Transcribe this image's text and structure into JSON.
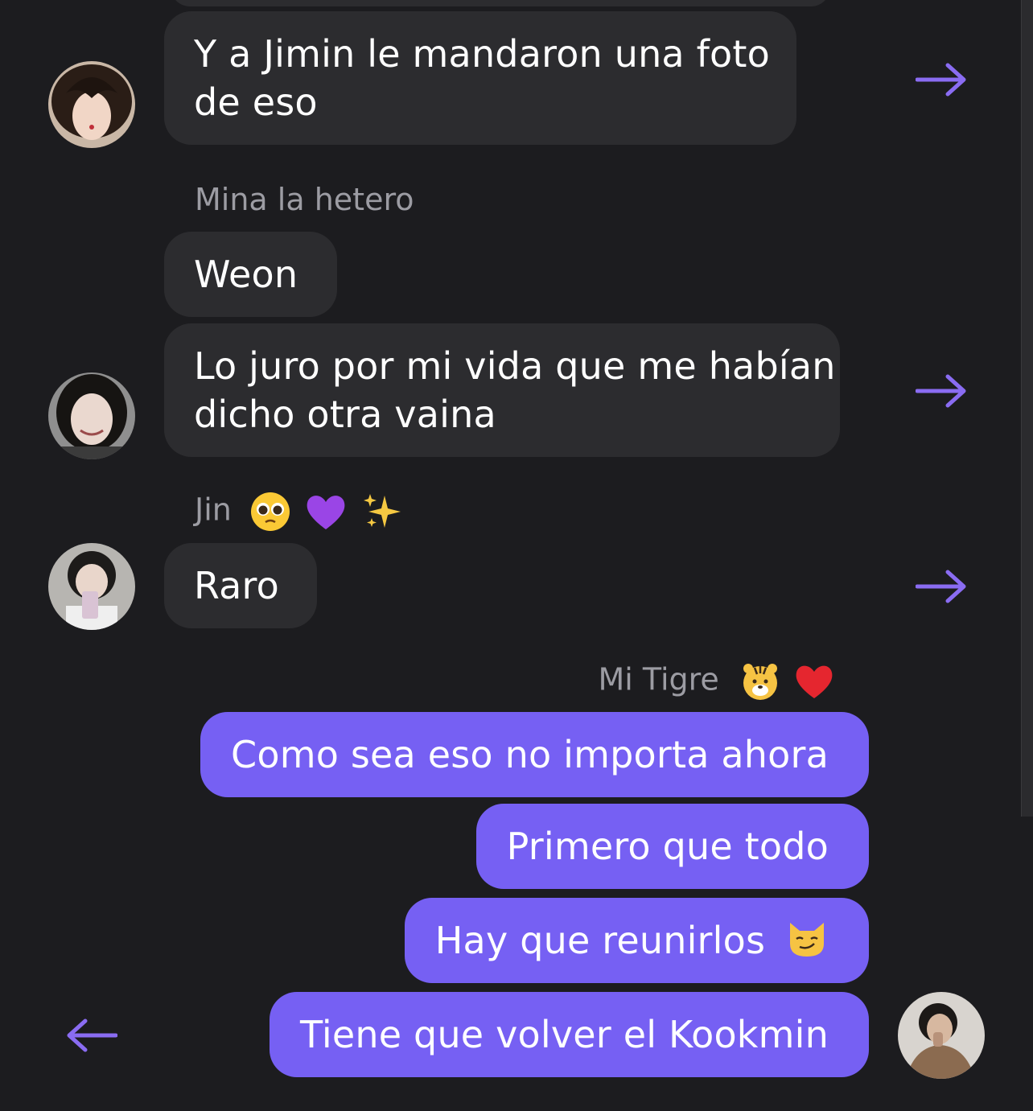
{
  "theme": {
    "background": "#1c1c1f",
    "incoming_bubble": "#2c2c2f",
    "outgoing_bubble": "#7660f3",
    "accent": "#8a6cf2"
  },
  "messages": [
    {
      "text_lines": [
        "Y a Jimin le mandaron una foto",
        "de eso"
      ],
      "direction": "incoming"
    },
    {
      "sender": "Mina la hetero",
      "text": "Weon",
      "direction": "incoming"
    },
    {
      "text_lines": [
        "Lo juro por mi vida que me habían",
        "dicho otra vaina"
      ],
      "direction": "incoming"
    },
    {
      "sender": "Jin",
      "sender_emojis": [
        "pleading-face",
        "purple-heart",
        "sparkles"
      ],
      "text": "Raro",
      "direction": "incoming"
    },
    {
      "sender": "Mi Tigre",
      "sender_emojis": [
        "tiger-face",
        "red-heart"
      ],
      "text": "Como sea eso no importa ahora",
      "direction": "outgoing"
    },
    {
      "text": "Primero que todo",
      "direction": "outgoing"
    },
    {
      "text": "Hay que reunirlos",
      "emoji": "smirking-cat",
      "direction": "outgoing"
    },
    {
      "text": "Tiene que volver el Kookmin",
      "direction": "outgoing"
    }
  ],
  "icons": {
    "reply_right": "arrow-right-icon",
    "reply_left": "arrow-left-icon"
  }
}
